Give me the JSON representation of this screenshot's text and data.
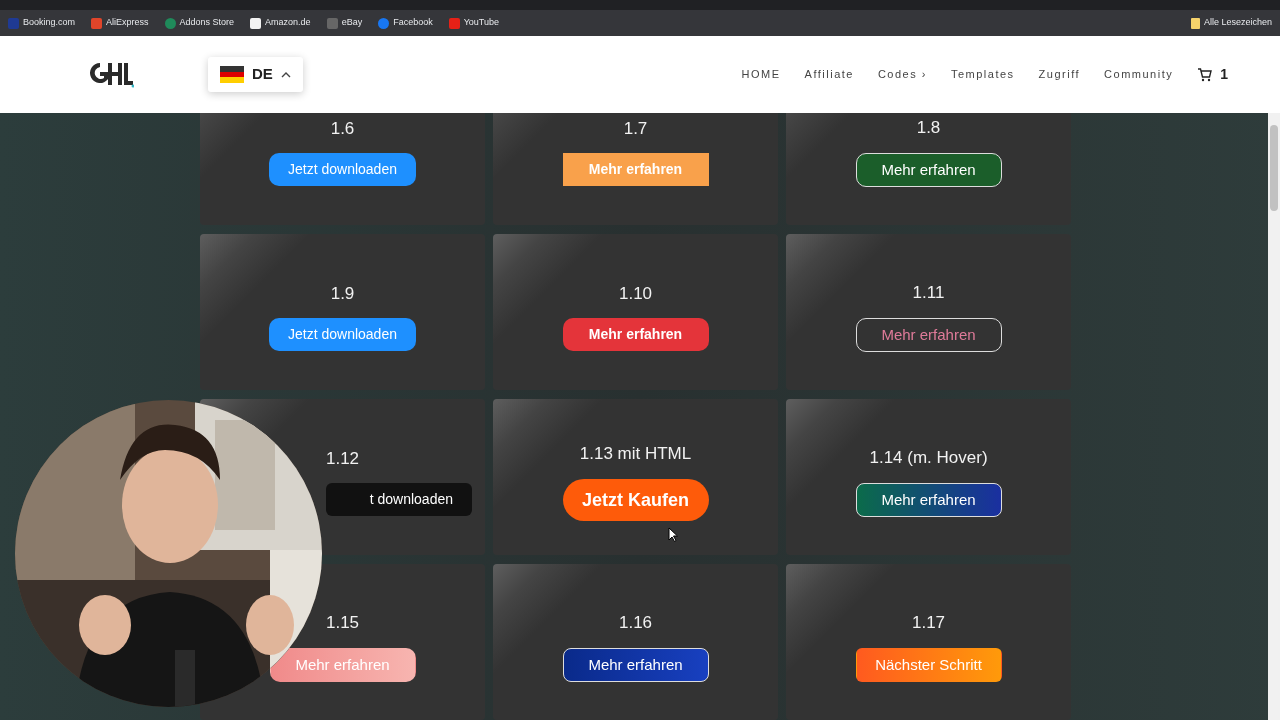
{
  "bookmarks": [
    {
      "label": "Booking.com"
    },
    {
      "label": "AliExpress"
    },
    {
      "label": "Addons Store"
    },
    {
      "label": "Amazon.de"
    },
    {
      "label": "eBay"
    },
    {
      "label": "Facebook"
    },
    {
      "label": "YouTube"
    }
  ],
  "all_bookmarks": "Alle Lesezeichen",
  "header": {
    "language": "DE",
    "nav": [
      {
        "label": "HOME"
      },
      {
        "label": "Affiliate"
      },
      {
        "label": "Codes ›"
      },
      {
        "label": "Templates"
      },
      {
        "label": "Zugriff"
      },
      {
        "label": "Community"
      }
    ],
    "cart_count": "1"
  },
  "cards": [
    {
      "title": "1.6",
      "button": "Jetzt downloaden"
    },
    {
      "title": "1.7",
      "button": "Mehr erfahren"
    },
    {
      "title": "1.8",
      "button": "Mehr erfahren"
    },
    {
      "title": "1.9",
      "button": "Jetzt downloaden"
    },
    {
      "title": "1.10",
      "button": "Mehr erfahren"
    },
    {
      "title": "1.11",
      "button": "Mehr erfahren"
    },
    {
      "title": "1.12",
      "button": "t downloaden"
    },
    {
      "title": "1.13 mit HTML",
      "button": "Jetzt Kaufen"
    },
    {
      "title": "1.14 (m. Hover)",
      "button": "Mehr erfahren"
    },
    {
      "title": "1.15",
      "button": "Mehr erfahren"
    },
    {
      "title": "1.16",
      "button": "Mehr erfahren"
    },
    {
      "title": "1.17",
      "button": "Nächster Schritt"
    }
  ]
}
